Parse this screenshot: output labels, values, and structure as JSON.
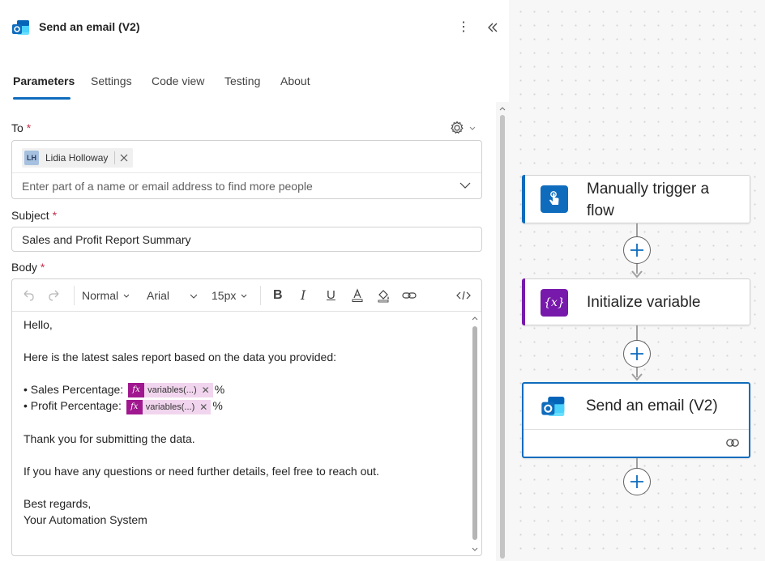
{
  "panel": {
    "title": "Send an email (V2)",
    "more_label": "⋮",
    "tabs": [
      "Parameters",
      "Settings",
      "Code view",
      "Testing",
      "About"
    ]
  },
  "form": {
    "to": {
      "label": "To",
      "required_mark": "*",
      "chip_initials": "LH",
      "chip_name": "Lidia Holloway",
      "placeholder": "Enter part of a name or email address to find more people"
    },
    "subject": {
      "label": "Subject",
      "required_mark": "*",
      "value": "Sales and Profit Report Summary"
    },
    "body": {
      "label": "Body",
      "required_mark": "*",
      "toolbar": {
        "format": "Normal",
        "font": "Arial",
        "size": "15px",
        "bold": "B",
        "italic": "I",
        "underline": "U"
      },
      "greeting": "Hello,",
      "intro": "Here is the latest sales report based on the data you provided:",
      "sales_label": "• Sales Percentage:",
      "profit_label": "• Profit Percentage:",
      "token_icon": "fx",
      "token_text": "variables(...)",
      "token_remove": "✕",
      "percent": "%",
      "thanks": "Thank you for submitting the data.",
      "questions": "If you have any questions or need further details, feel free to reach out.",
      "closing": "Best regards,",
      "signature": "Your Automation System"
    }
  },
  "canvas": {
    "nodes": [
      {
        "title_line1": "Manually trigger a",
        "title_line2": "flow",
        "accent": "#0f6cbd",
        "icon": "touch-hand-icon"
      },
      {
        "title": "Initialize variable",
        "accent": "#7719aa",
        "icon": "variable-icon",
        "icon_text": "{x}"
      },
      {
        "title": "Send an email (V2)",
        "accent": "#0f6cbd",
        "icon": "outlook-icon",
        "selected": true
      }
    ]
  },
  "colors": {
    "brand": "#0f6cbd",
    "variable_purple": "#7719aa",
    "expression_magenta": "#a0188f",
    "required_red": "#c4314b"
  }
}
